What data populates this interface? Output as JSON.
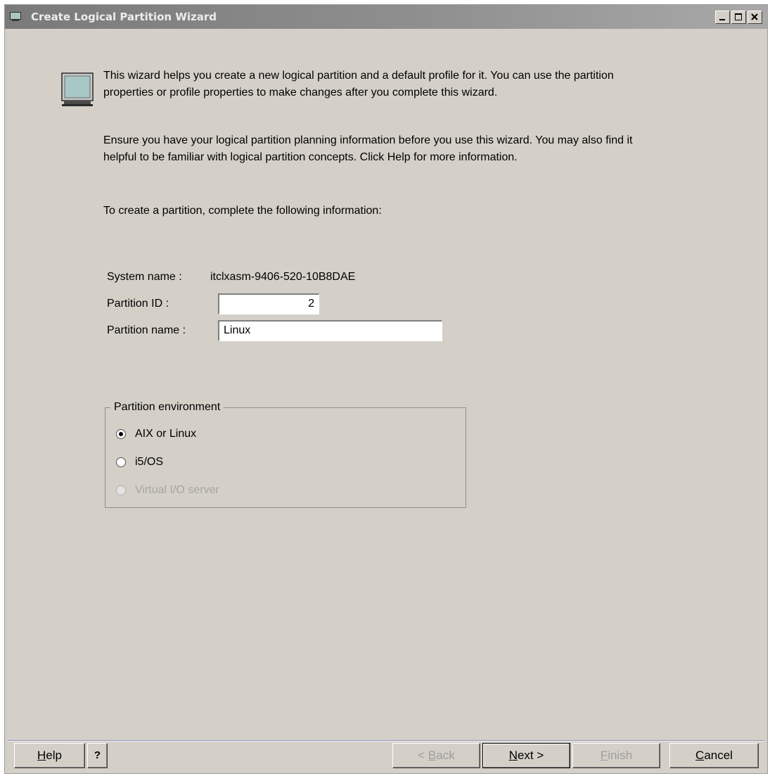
{
  "window": {
    "title": "Create Logical Partition Wizard",
    "controls": {
      "minimize": "minimize",
      "maximize": "maximize",
      "close": "close"
    }
  },
  "intro": {
    "paragraph1": "This wizard helps you create a new logical partition and a default profile for it.  You can use the partition properties or profile properties to make changes after you complete this wizard.",
    "paragraph2": "Ensure you have your logical partition planning information before you use this wizard. You may also find it helpful to be familiar with logical partition concepts. Click Help for more information.",
    "paragraph3": "To create a partition, complete the following information:"
  },
  "form": {
    "system_name_label": "System name :",
    "system_name_value": "itclxasm-9406-520-10B8DAE",
    "partition_id_label": "Partition ID :",
    "partition_id_value": "2",
    "partition_name_label": "Partition name :",
    "partition_name_value": "Linux"
  },
  "environment": {
    "legend": "Partition environment",
    "options": [
      {
        "label": "AIX or Linux",
        "selected": true,
        "enabled": true
      },
      {
        "label": "i5/OS",
        "selected": false,
        "enabled": true
      },
      {
        "label": "Virtual I/O server",
        "selected": false,
        "enabled": false
      }
    ]
  },
  "buttons": {
    "help": {
      "mnemonic": "H",
      "rest": "elp"
    },
    "help_question": "?",
    "back": {
      "prefix": "< ",
      "mnemonic": "B",
      "rest": "ack"
    },
    "next": {
      "mnemonic": "N",
      "rest": "ext >"
    },
    "finish": {
      "mnemonic": "F",
      "rest": "inish"
    },
    "cancel": {
      "mnemonic": "C",
      "rest": "ancel"
    }
  },
  "icons": [
    "window-icon",
    "computer-monitor-icon",
    "minimize-icon",
    "maximize-icon",
    "close-icon"
  ],
  "colors": {
    "title_bar": "#8f8f8f",
    "dialog_background": "#d4d0c8",
    "separator": "#8c8fb8",
    "disabled_text": "#9d9d9d"
  }
}
